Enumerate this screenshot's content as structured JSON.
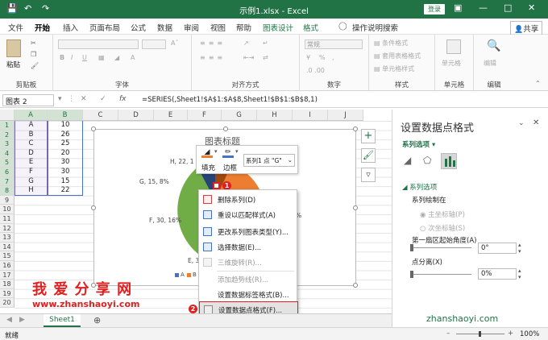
{
  "window": {
    "title": "示例1.xlsx  -  Excel",
    "login": "登录"
  },
  "tabs": [
    "文件",
    "开始",
    "插入",
    "页面布局",
    "公式",
    "数据",
    "审阅",
    "视图",
    "帮助",
    "图表设计",
    "格式",
    "操作说明搜索"
  ],
  "share": "共享",
  "ribbon": {
    "paste": "粘贴",
    "groups": [
      "剪贴板",
      "字体",
      "对齐方式",
      "数字",
      "样式",
      "单元格",
      "编辑"
    ],
    "number_format": "常规",
    "styles": [
      "条件格式",
      "套用表格格式",
      "单元格样式"
    ],
    "cells": "单元格",
    "editing": "编辑"
  },
  "formula_bar": {
    "name_box": "图表 2",
    "fx": "fx",
    "formula": "=SERIES(,Sheet1!$A$1:$A$8,Sheet1!$B$1:$B$8,1)"
  },
  "columns": [
    "A",
    "B",
    "C",
    "D",
    "E",
    "F",
    "G",
    "H",
    "I",
    "J"
  ],
  "rows": [
    "1",
    "2",
    "3",
    "4",
    "5",
    "6",
    "7",
    "8",
    "9",
    "10",
    "11",
    "12",
    "13",
    "14",
    "15",
    "16",
    "17",
    "18",
    "19",
    "20"
  ],
  "table": [
    [
      "A",
      "10"
    ],
    [
      "B",
      "26"
    ],
    [
      "C",
      "25"
    ],
    [
      "D",
      "20"
    ],
    [
      "E",
      "30"
    ],
    [
      "F",
      "30"
    ],
    [
      "G",
      "15"
    ],
    [
      "H",
      "22"
    ]
  ],
  "chart": {
    "title": "图表标题",
    "labels": [
      "H, 22, 1",
      "G, 15, 8%",
      "F, 30, 16%",
      "E, 3",
      "%"
    ],
    "legend": [
      "A",
      "B"
    ]
  },
  "mini_toolbar": {
    "fill": "填充",
    "border": "边框",
    "series_select": "系列1 点 \"G\""
  },
  "context_menu": [
    {
      "label": "删除系列(D)",
      "enabled": true
    },
    {
      "label": "重设以匹配样式(A)",
      "enabled": true
    },
    {
      "label": "更改系列图表类型(Y)...",
      "enabled": true
    },
    {
      "label": "选择数据(E)...",
      "enabled": true
    },
    {
      "label": "三维旋转(R)...",
      "enabled": false
    },
    {
      "label": "添加趋势线(R)...",
      "enabled": false
    },
    {
      "label": "设置数据标签格式(B)...",
      "enabled": true
    },
    {
      "label": "设置数据点格式(F)...",
      "enabled": true
    }
  ],
  "badges": [
    "1",
    "2"
  ],
  "watermark": {
    "title": "我 爱 分 享 网",
    "url": "www.zhanshaoyi.com",
    "corner": "zhanshaoyi.com"
  },
  "pane": {
    "title": "设置数据点格式",
    "subtitle": "系列选项",
    "section": "系列选项",
    "plot_on": "系列绘制在",
    "primary_axis": "主坐标轴(P)",
    "secondary_axis": "次坐标轴(S)",
    "angle_label": "第一扇区起始角度(A)",
    "angle_value": "0°",
    "explosion_label": "点分离(X)",
    "explosion_value": "0%"
  },
  "sheet_tab": "Sheet1",
  "status": {
    "ready": "就绪",
    "zoom": "100%"
  },
  "colors": {
    "excel_green": "#217346",
    "blue_slice": "#4472c4",
    "orange_slice": "#ed7d31",
    "green_slice": "#70ad47",
    "highlight_red": "#e02020"
  }
}
